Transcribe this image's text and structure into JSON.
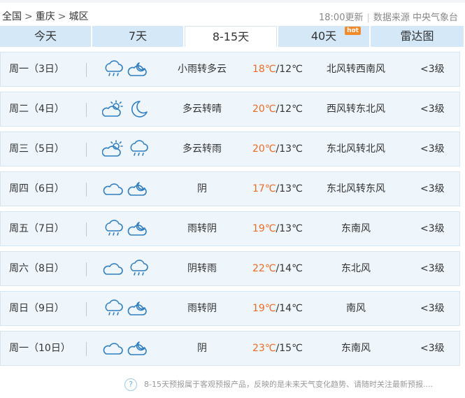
{
  "breadcrumb": {
    "items": [
      "全国",
      "重庆",
      "城区"
    ],
    "separator": ">"
  },
  "source": {
    "update_time": "18:00更新",
    "label": "数据来源 中央气象台"
  },
  "tabs": [
    {
      "label": "今天",
      "active": false,
      "hot": ""
    },
    {
      "label": "7天",
      "active": false,
      "hot": ""
    },
    {
      "label": "8-15天",
      "active": true,
      "hot": ""
    },
    {
      "label": "40天",
      "active": false,
      "hot": "hot"
    },
    {
      "label": "雷达图",
      "active": false,
      "hot": ""
    }
  ],
  "forecast": [
    {
      "day": "周一（3日）",
      "icons": [
        "rain-cloud-icon",
        "partly-cloudy-moon-icon"
      ],
      "desc": "小雨转多云",
      "high": "18℃",
      "low": "/12℃",
      "wind": "北风转西南风",
      "level": "<3级"
    },
    {
      "day": "周二（4日）",
      "icons": [
        "partly-cloudy-sun-icon",
        "moon-icon"
      ],
      "desc": "多云转晴",
      "high": "20℃",
      "low": "/12℃",
      "wind": "西风转东北风",
      "level": "<3级"
    },
    {
      "day": "周三（5日）",
      "icons": [
        "partly-cloudy-sun-icon",
        "rain-cloud-icon"
      ],
      "desc": "多云转雨",
      "high": "20℃",
      "low": "/13℃",
      "wind": "东北风转北风",
      "level": "<3级"
    },
    {
      "day": "周四（6日）",
      "icons": [
        "overcast-cloud-icon",
        "partly-cloudy-moon-icon"
      ],
      "desc": "阴",
      "high": "17℃",
      "low": "/13℃",
      "wind": "东北风转东风",
      "level": "<3级"
    },
    {
      "day": "周五（7日）",
      "icons": [
        "rain-cloud-icon",
        "partly-cloudy-moon-icon"
      ],
      "desc": "雨转阴",
      "high": "19℃",
      "low": "/13℃",
      "wind": "东南风",
      "level": "<3级"
    },
    {
      "day": "周六（8日）",
      "icons": [
        "overcast-cloud-icon",
        "rain-cloud-icon"
      ],
      "desc": "阴转雨",
      "high": "22℃",
      "low": "/14℃",
      "wind": "东北风",
      "level": "<3级"
    },
    {
      "day": "周日（9日）",
      "icons": [
        "rain-cloud-icon",
        "partly-cloudy-moon-icon"
      ],
      "desc": "雨转阴",
      "high": "19℃",
      "low": "/14℃",
      "wind": "南风",
      "level": "<3级"
    },
    {
      "day": "周一（10日）",
      "icons": [
        "overcast-cloud-icon",
        "partly-cloudy-moon-icon"
      ],
      "desc": "阴",
      "high": "23℃",
      "low": "/15℃",
      "wind": "东南风",
      "level": "<3级"
    }
  ],
  "footer": {
    "help_glyph": "?",
    "text": "8-15天预报属于客观预报产品，反映的是未来天气变化趋势、请随时关注最新预报...."
  },
  "colors": {
    "tab_bg": "#d4e8f8",
    "row_bg": "#eef5fb",
    "high_temp": "#f06b22",
    "icon": "#2f7fc2"
  }
}
